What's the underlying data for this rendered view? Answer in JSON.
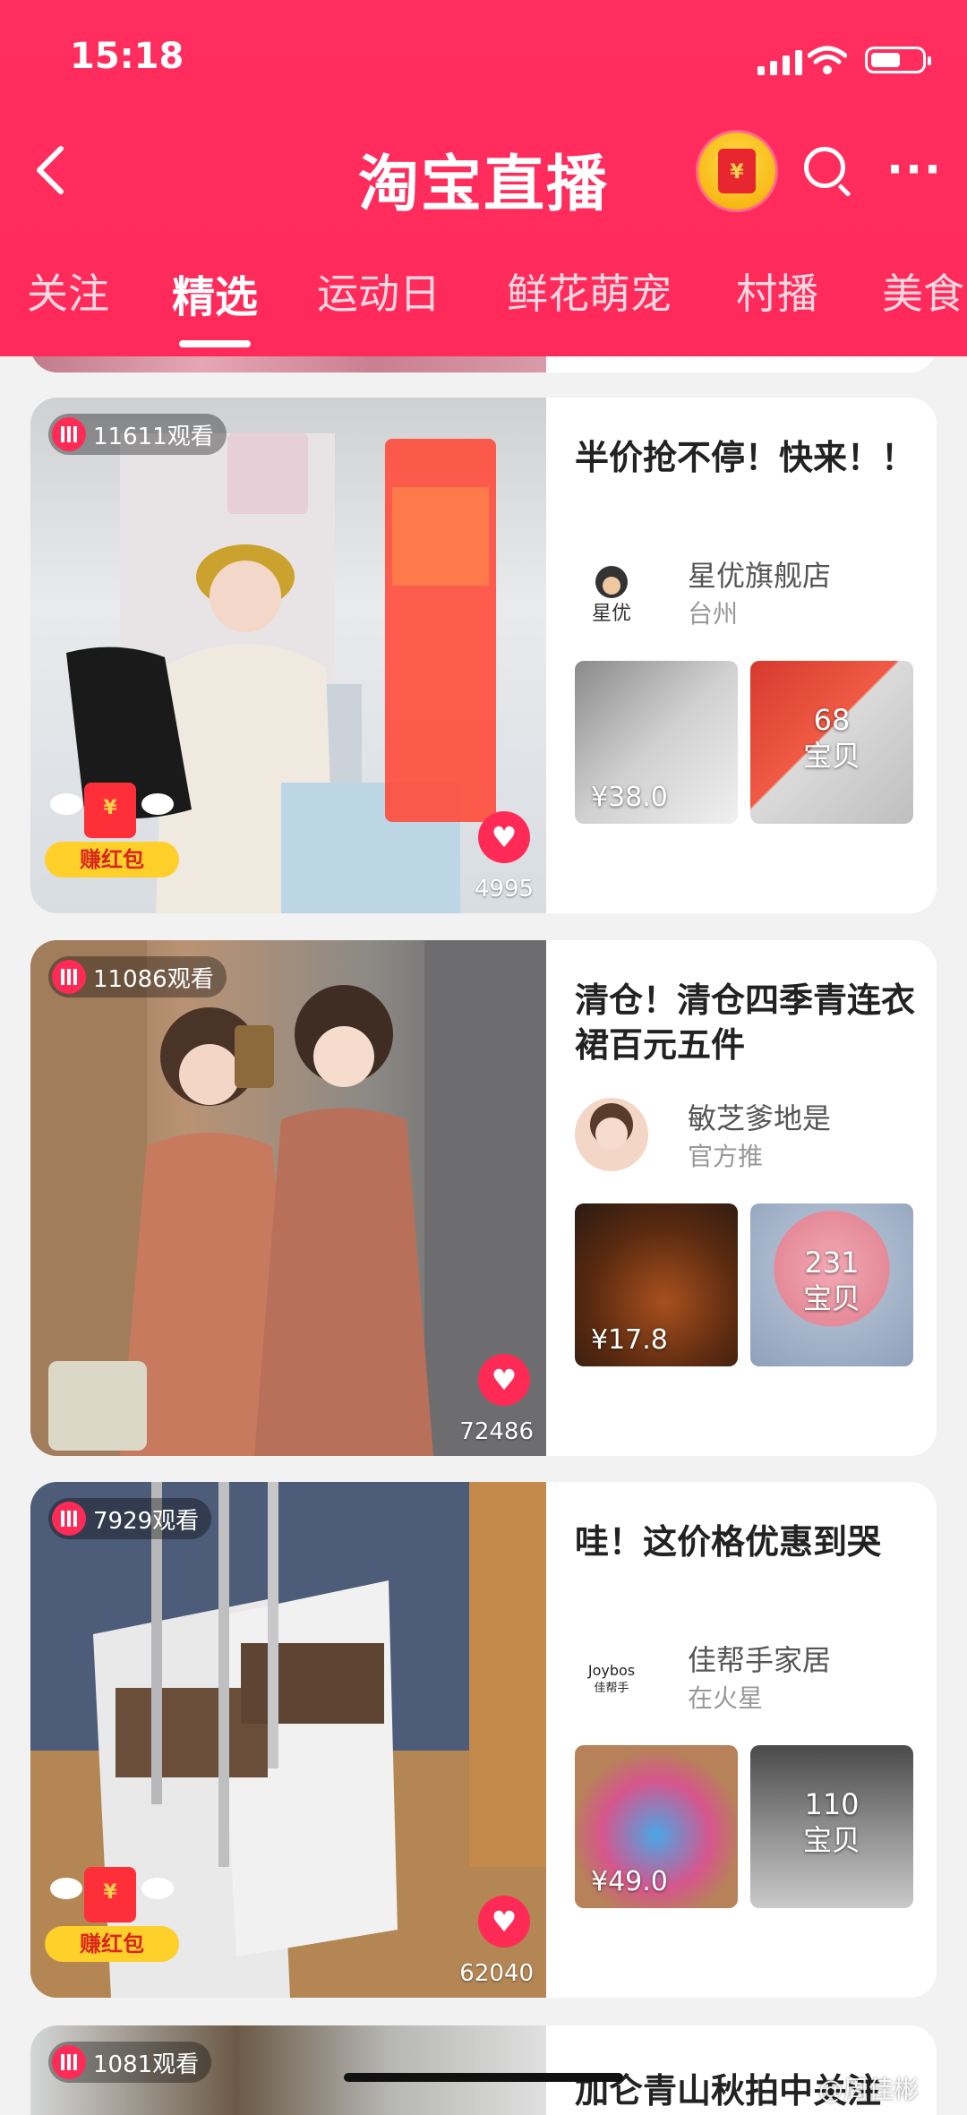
{
  "status_bar": {
    "time": "15:18"
  },
  "header": {
    "title": "淘宝直播",
    "back_icon": "chevron-left-icon",
    "tabs": [
      {
        "label": "关注"
      },
      {
        "label": "精选"
      },
      {
        "label": "运动日"
      },
      {
        "label": "鲜花萌宠"
      },
      {
        "label": "村播"
      },
      {
        "label": "美食"
      }
    ],
    "active_tab": "精选"
  },
  "cards": [
    {
      "viewers": "11611观看",
      "likes": "4995",
      "badge": "赚红包",
      "title": "半价抢不停！快来！！",
      "shop_name": "星优旗舰店",
      "shop_sub": "台州",
      "product_price": "¥38.0",
      "items_count": "68",
      "items_label": "宝贝"
    },
    {
      "viewers": "11086观看",
      "likes": "72486",
      "title": "清仓！清仓四季青连衣裙百元五件",
      "shop_name": "敏芝爹地是",
      "shop_sub": "官方推",
      "product_price": "¥17.8",
      "items_count": "231",
      "items_label": "宝贝"
    },
    {
      "viewers": "7929观看",
      "likes": "62040",
      "badge": "赚红包",
      "title": "哇！这价格优惠到哭",
      "shop_name": "佳帮手家居",
      "shop_sub": "在火星",
      "product_price": "¥49.0",
      "items_count": "110",
      "items_label": "宝贝"
    }
  ],
  "partial_card": {
    "viewers": "1081观看",
    "title": "加仑青山秋拍中关注"
  },
  "watermark": "@周佳彬",
  "colors": {
    "brand": "#ff2e5f",
    "like": "#ff2a55"
  }
}
